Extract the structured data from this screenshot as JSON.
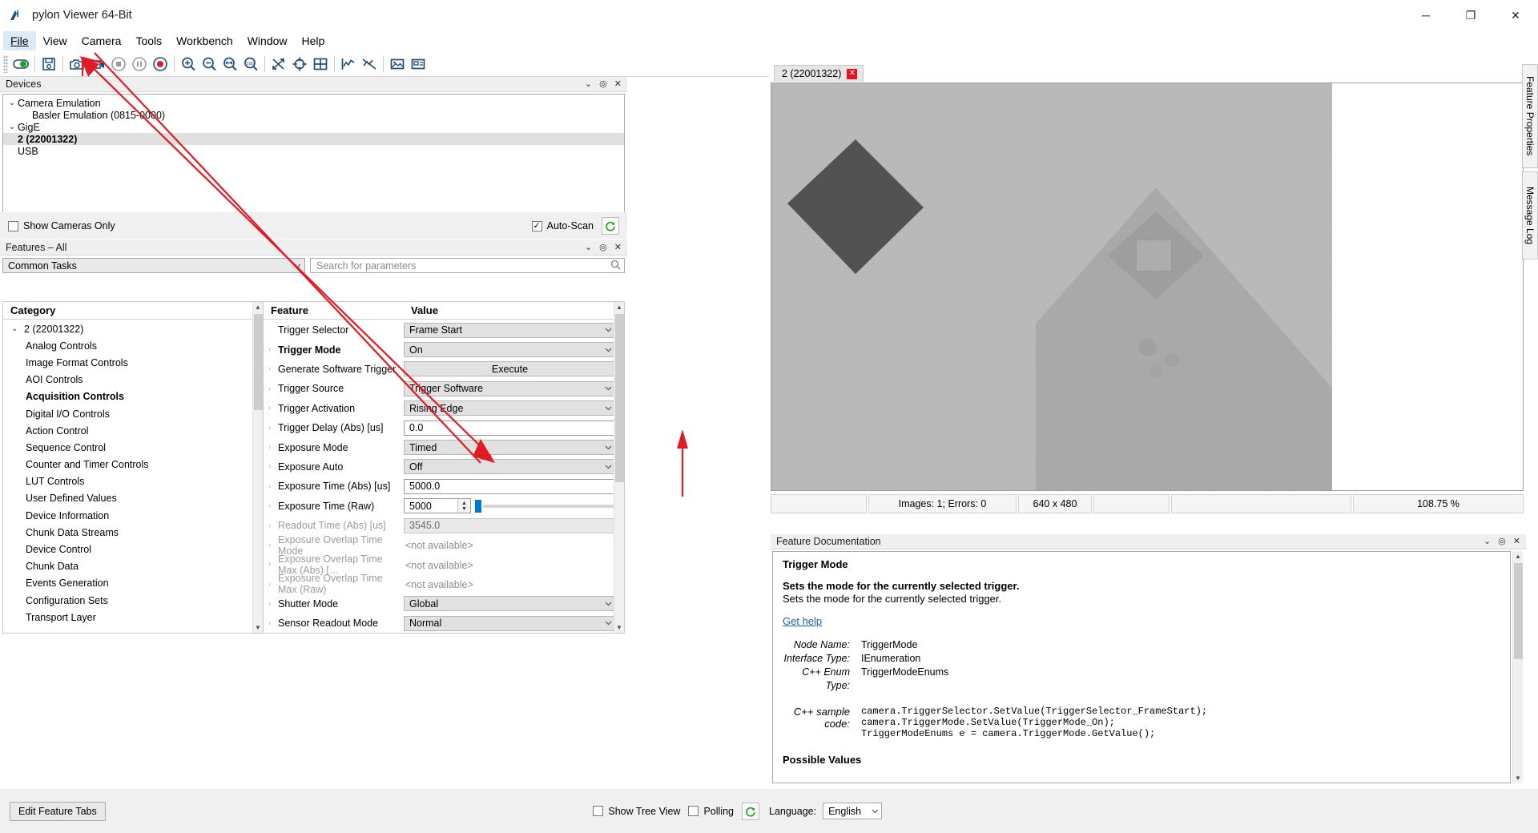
{
  "window": {
    "title": "pylon Viewer 64-Bit",
    "minimize": "─",
    "maximize": "❐",
    "close": "✕"
  },
  "menubar": {
    "items": [
      {
        "label": "File"
      },
      {
        "label": "View"
      },
      {
        "label": "Camera"
      },
      {
        "label": "Tools"
      },
      {
        "label": "Workbench"
      },
      {
        "label": "Window"
      },
      {
        "label": "Help"
      }
    ]
  },
  "toolbar": {
    "buttons": [
      {
        "name": "open-device-icon",
        "title": "Open Device"
      },
      {
        "name": "save-icon",
        "title": "Save"
      },
      {
        "name": "single-shot-icon",
        "title": "Single Shot"
      },
      {
        "name": "continuous-shot-icon",
        "title": "Continuous Shot"
      },
      {
        "name": "stop-icon",
        "title": "Stop"
      },
      {
        "name": "pause-icon",
        "title": "Pause"
      },
      {
        "name": "record-icon",
        "title": "Record"
      },
      {
        "name": "zoom-in-icon",
        "title": "Zoom In"
      },
      {
        "name": "zoom-out-icon",
        "title": "Zoom Out"
      },
      {
        "name": "fit-to-window-icon",
        "title": "Fit to Window"
      },
      {
        "name": "zoom-100-icon",
        "title": "Zoom 100%"
      },
      {
        "name": "shuffle-icon",
        "title": "Scatter Windows"
      },
      {
        "name": "crosshair-icon",
        "title": "Crosshair"
      },
      {
        "name": "grid-icon",
        "title": "Grid"
      },
      {
        "name": "histogram-icon",
        "title": "Histogram"
      },
      {
        "name": "hide-overlay-icon",
        "title": "Hide Overlay"
      },
      {
        "name": "image-icon",
        "title": "Image"
      },
      {
        "name": "image-window-icon",
        "title": "Image Window"
      }
    ]
  },
  "devices": {
    "panel_title": "Devices",
    "panel_buttons": [
      "⌄",
      "◎",
      "✕"
    ],
    "tree": [
      {
        "label": "Camera Emulation",
        "level": 0,
        "chevron": "⌄",
        "selected": false
      },
      {
        "label": "Basler Emulation (0815-0000)",
        "level": 2,
        "chevron": "",
        "selected": false
      },
      {
        "label": "GigE",
        "level": 0,
        "chevron": "⌄",
        "selected": false
      },
      {
        "label": "2 (22001322)",
        "level": 1,
        "chevron": "",
        "selected": true
      },
      {
        "label": "USB",
        "level": 1,
        "chevron": "",
        "selected": false
      }
    ],
    "show_cameras_only": "Show Cameras Only",
    "show_cameras_only_checked": false,
    "auto_scan": "Auto-Scan",
    "auto_scan_checked": true,
    "refresh_icon": "⟳"
  },
  "features": {
    "panel_title": "Features – All",
    "panel_buttons": [
      "⌄",
      "◎",
      "✕"
    ],
    "task_combo_value": "Common Tasks",
    "search_placeholder": "Search for parameters",
    "category_header": "Category",
    "feature_header": "Feature",
    "value_header": "Value",
    "categories": [
      {
        "label": "2 (22001322)",
        "chevron": "⌄",
        "bold": false,
        "more": false
      },
      {
        "label": "Analog Controls",
        "chevron": "",
        "bold": false,
        "more": true
      },
      {
        "label": "Image Format Controls",
        "chevron": "",
        "bold": false,
        "more": true
      },
      {
        "label": "AOI Controls",
        "chevron": "",
        "bold": false,
        "more": true
      },
      {
        "label": "Acquisition Controls",
        "chevron": "",
        "bold": true,
        "more": true
      },
      {
        "label": "Digital I/O Controls",
        "chevron": "",
        "bold": false,
        "more": true
      },
      {
        "label": "Action Control",
        "chevron": "",
        "bold": false,
        "more": true
      },
      {
        "label": "Sequence Control",
        "chevron": "",
        "bold": false,
        "more": true
      },
      {
        "label": "Counter and Timer Controls",
        "chevron": "",
        "bold": false,
        "more": true
      },
      {
        "label": "LUT Controls",
        "chevron": "",
        "bold": false,
        "more": true
      },
      {
        "label": "User Defined Values",
        "chevron": "",
        "bold": false,
        "more": true
      },
      {
        "label": "Device Information",
        "chevron": "",
        "bold": false,
        "more": true
      },
      {
        "label": "Chunk Data Streams",
        "chevron": "",
        "bold": false,
        "more": true
      },
      {
        "label": "Device Control",
        "chevron": "",
        "bold": false,
        "more": true
      },
      {
        "label": "Chunk Data",
        "chevron": "",
        "bold": false,
        "more": true
      },
      {
        "label": "Events Generation",
        "chevron": "",
        "bold": false,
        "more": true
      },
      {
        "label": "Configuration Sets",
        "chevron": "",
        "bold": false,
        "more": true
      },
      {
        "label": "Transport Layer",
        "chevron": "",
        "bold": false,
        "more": true
      }
    ],
    "rows": [
      {
        "name": "Trigger Selector",
        "bold": false,
        "disabled": false,
        "kind": "combo",
        "value": "Frame Start",
        "chevron": ""
      },
      {
        "name": "Trigger Mode",
        "bold": true,
        "disabled": false,
        "kind": "combo",
        "value": "On",
        "chevron": "›"
      },
      {
        "name": "Generate Software Trigger",
        "bold": false,
        "disabled": false,
        "kind": "button",
        "value": "Execute",
        "chevron": "›"
      },
      {
        "name": "Trigger Source",
        "bold": false,
        "disabled": false,
        "kind": "combo",
        "value": "Trigger Software",
        "chevron": "›"
      },
      {
        "name": "Trigger Activation",
        "bold": false,
        "disabled": false,
        "kind": "combo",
        "value": "Rising Edge",
        "chevron": "›"
      },
      {
        "name": "Trigger Delay (Abs) [us]",
        "bold": false,
        "disabled": false,
        "kind": "input",
        "value": "0.0",
        "chevron": "›"
      },
      {
        "name": "Exposure Mode",
        "bold": false,
        "disabled": false,
        "kind": "combo",
        "value": "Timed",
        "chevron": "›"
      },
      {
        "name": "Exposure Auto",
        "bold": false,
        "disabled": false,
        "kind": "combo",
        "value": "Off",
        "chevron": "›"
      },
      {
        "name": "Exposure Time (Abs) [us]",
        "bold": false,
        "disabled": false,
        "kind": "input",
        "value": "5000.0",
        "chevron": "›"
      },
      {
        "name": "Exposure Time (Raw)",
        "bold": false,
        "disabled": false,
        "kind": "spin",
        "value": "5000",
        "chevron": "›"
      },
      {
        "name": "Readout Time (Abs) [us]",
        "bold": false,
        "disabled": true,
        "kind": "input-disabled",
        "value": "3545.0",
        "chevron": "›"
      },
      {
        "name": "Exposure Overlap Time Mode",
        "bold": false,
        "disabled": true,
        "kind": "na",
        "value": "<not available>",
        "chevron": "›"
      },
      {
        "name": "Exposure Overlap Time Max (Abs) […",
        "bold": false,
        "disabled": true,
        "kind": "na",
        "value": "<not available>",
        "chevron": "›"
      },
      {
        "name": "Exposure Overlap Time Max (Raw)",
        "bold": false,
        "disabled": true,
        "kind": "na",
        "value": "<not available>",
        "chevron": "›"
      },
      {
        "name": "Shutter Mode",
        "bold": false,
        "disabled": false,
        "kind": "combo",
        "value": "Global",
        "chevron": "›"
      },
      {
        "name": "Sensor Readout Mode",
        "bold": false,
        "disabled": false,
        "kind": "combo",
        "value": "Normal",
        "chevron": "›"
      }
    ]
  },
  "bottom": {
    "edit_feature_tabs": "Edit Feature Tabs",
    "show_tree_view": "Show Tree View",
    "show_tree_view_checked": false,
    "polling": "Polling",
    "polling_checked": false,
    "refresh_icon": "⟳",
    "language_label": "Language:",
    "language_value": "English"
  },
  "image": {
    "tab_label": "2 (22001322)",
    "tab_close": "✕",
    "status": {
      "cell1": "",
      "images_errors": "Images: 1; Errors: 0",
      "resolution": "640 x 480",
      "cell4": "",
      "cell5": "",
      "zoom": "108.75 %"
    }
  },
  "doc": {
    "panel_title": "Feature Documentation",
    "panel_buttons": [
      "⌄",
      "◎",
      "✕"
    ],
    "heading": "Trigger Mode",
    "summary_bold": "Sets the mode for the currently selected trigger.",
    "summary_plain": "Sets the mode for the currently selected trigger.",
    "get_help": "Get help",
    "meta": [
      {
        "key": "Node Name:",
        "value": "TriggerMode"
      },
      {
        "key": "Interface Type:",
        "value": "IEnumeration"
      },
      {
        "key": "C++ Enum Type:",
        "value": "TriggerModeEnums"
      }
    ],
    "sample_key": "C++ sample code:",
    "sample_lines": [
      "camera.TriggerSelector.SetValue(TriggerSelector_FrameStart);",
      "camera.TriggerMode.SetValue(TriggerMode_On);",
      "TriggerModeEnums e = camera.TriggerMode.GetValue();"
    ],
    "possible_values": "Possible Values"
  },
  "right_tabs": [
    {
      "label": "Feature Properties"
    },
    {
      "label": "Message Log"
    }
  ],
  "colors": {
    "accent": "#0078d7",
    "annotation": "#e01b24",
    "tab_close_red": "#e81123",
    "link": "#1a5fb4"
  }
}
